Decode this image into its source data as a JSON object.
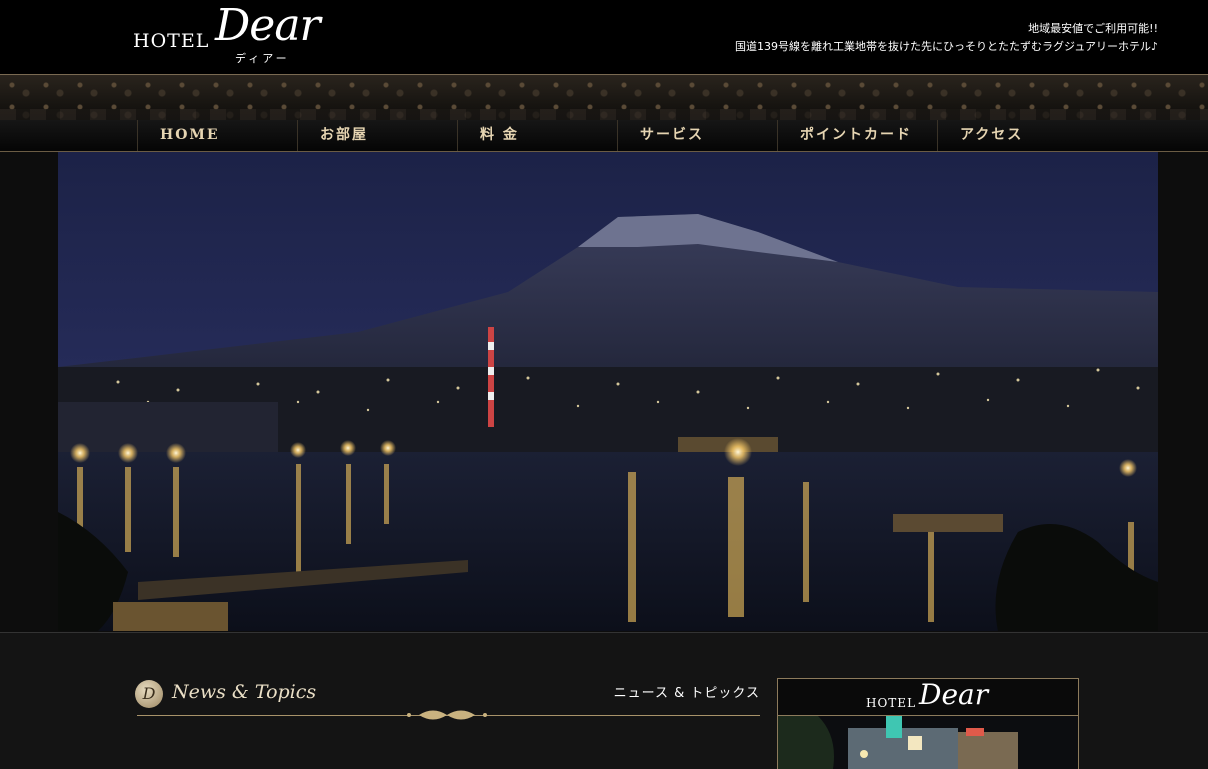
{
  "header": {
    "logo_hotel": "HOTEL",
    "logo_dear": "Dear",
    "logo_kana": "ディアー",
    "tagline_line1": "地域最安値でご利用可能!!",
    "tagline_line2": "国道139号線を離れ工業地帯を抜けた先にひっそりとたたずむラグジュアリーホテル♪"
  },
  "nav": {
    "items": [
      {
        "label": "HOME"
      },
      {
        "label": "お部屋"
      },
      {
        "label": "料 金"
      },
      {
        "label": "サービス"
      },
      {
        "label": "ポイントカード"
      },
      {
        "label": "アクセス"
      }
    ]
  },
  "news": {
    "badge": "D",
    "title": "News & Topics",
    "title_kana": "ニュース & トピックス"
  },
  "side": {
    "hotel": "HOTEL",
    "dear": "Dear"
  },
  "colors": {
    "background": "#141414",
    "gold": "#a8936a",
    "nav_text": "#e6d5b2"
  }
}
